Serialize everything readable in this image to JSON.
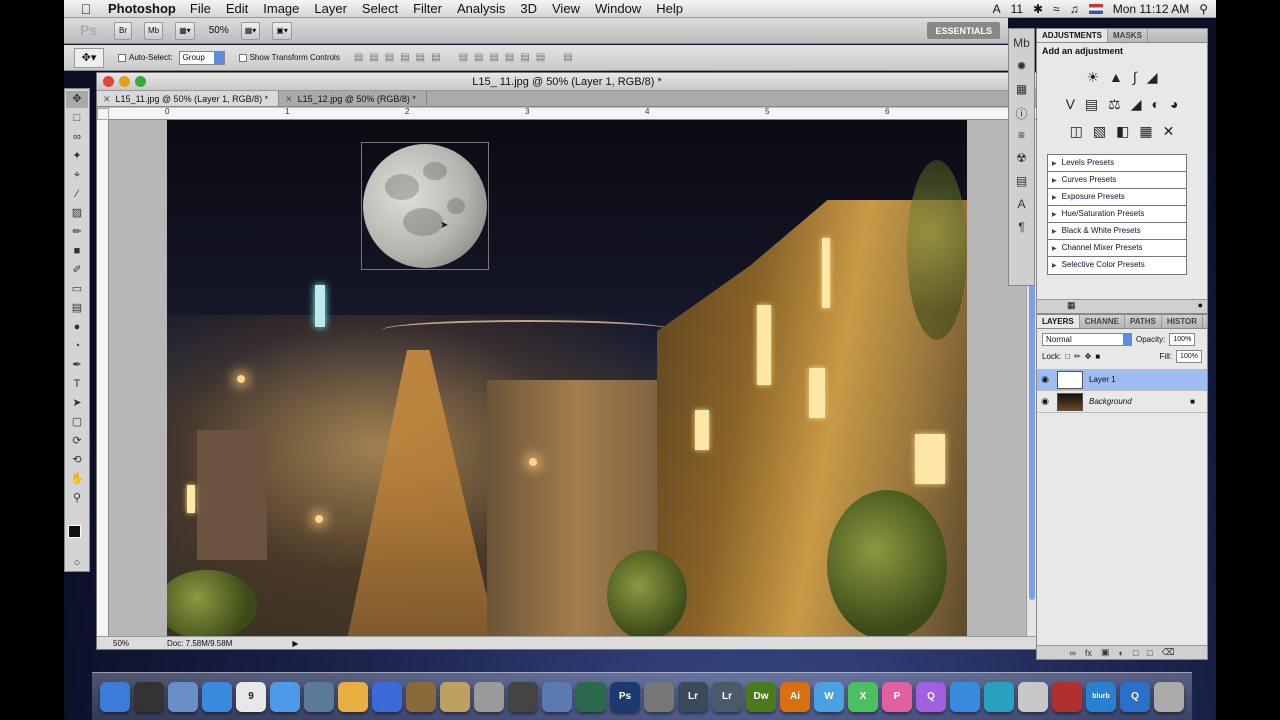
{
  "menubar": {
    "app": "Photoshop",
    "items": [
      "File",
      "Edit",
      "Image",
      "Layer",
      "Select",
      "Filter",
      "Analysis",
      "3D",
      "View",
      "Window",
      "Help"
    ],
    "status_11": "11",
    "clock": "Mon 11:12 AM"
  },
  "appbar": {
    "ps_logo": "Ps",
    "bridge_btn": "Br",
    "minibridge_btn": "Mb",
    "zoom": "50%",
    "workspace": "ESSENTIALS"
  },
  "options": {
    "auto_select_label": "Auto-Select:",
    "auto_select_value": "Group",
    "transform_label": "Show Transform Controls"
  },
  "document": {
    "title": "L15_ 11.jpg @ 50% (Layer 1, RGB/8) *",
    "tabs": [
      "L15_11.jpg @ 50% (Layer 1, RGB/8) *",
      "L15_12.jpg @ 50% (RGB/8) *"
    ],
    "ruler_numbers": [
      "0",
      "1",
      "2",
      "3",
      "4",
      "5",
      "6"
    ],
    "status_zoom": "50%",
    "doc_size": "Doc: 7.58M/9.58M"
  },
  "adjustments": {
    "tabs": [
      "ADJUSTMENTS",
      "MASKS"
    ],
    "heading": "Add an adjustment",
    "presets": [
      "Levels Presets",
      "Curves Presets",
      "Exposure Presets",
      "Hue/Saturation Presets",
      "Black & White Presets",
      "Channel Mixer Presets",
      "Selective Color Presets"
    ]
  },
  "layers": {
    "tabs": [
      "LAYERS",
      "CHANNE",
      "PATHS",
      "HISTOR"
    ],
    "blend_mode": "Normal",
    "opacity_label": "Opacity:",
    "opacity": "100%",
    "lock_label": "Lock:",
    "fill_label": "Fill:",
    "fill": "100%",
    "items": [
      {
        "name": "Layer 1",
        "selected": true
      },
      {
        "name": "Background",
        "selected": false
      }
    ]
  },
  "dock": {
    "items": [
      {
        "icon": "finder-icon",
        "label": "",
        "color": "#3d7bd8"
      },
      {
        "icon": "dashboard-icon",
        "label": "",
        "color": "#333333"
      },
      {
        "icon": "preview-icon",
        "label": "",
        "color": "#6a8fc8"
      },
      {
        "icon": "safari-icon",
        "label": "",
        "color": "#3a8ae0"
      },
      {
        "icon": "ical-icon",
        "label": "9",
        "color": "#e8e8e8"
      },
      {
        "icon": "ichat-icon",
        "label": "",
        "color": "#4c9ae8"
      },
      {
        "icon": "iphoto-icon",
        "label": "",
        "color": "#5a7a9a"
      },
      {
        "icon": "notes-icon",
        "label": "",
        "color": "#e8b040"
      },
      {
        "icon": "itunes-icon",
        "label": "",
        "color": "#3a6ad8"
      },
      {
        "icon": "photo-icon",
        "label": "",
        "color": "#8a6a3a"
      },
      {
        "icon": "garageband-icon",
        "label": "",
        "color": "#c0a060"
      },
      {
        "icon": "imovie-icon",
        "label": "",
        "color": "#9a9a9a"
      },
      {
        "icon": "clapper-icon",
        "label": "",
        "color": "#444444"
      },
      {
        "icon": "grid-icon",
        "label": "",
        "color": "#5a7ab0"
      },
      {
        "icon": "timemachine-icon",
        "label": "",
        "color": "#2a6a4a"
      },
      {
        "icon": "photoshop-icon",
        "label": "Ps",
        "color": "#1c3a70"
      },
      {
        "icon": "screen-icon",
        "label": "",
        "color": "#777777"
      },
      {
        "icon": "lightroom-icon",
        "label": "Lr",
        "color": "#3a4a5a"
      },
      {
        "icon": "lightroom2-icon",
        "label": "Lr",
        "color": "#4a5a6a"
      },
      {
        "icon": "dreamweaver-icon",
        "label": "Dw",
        "color": "#4a7a1a"
      },
      {
        "icon": "illustrator-icon",
        "label": "Ai",
        "color": "#d87010"
      },
      {
        "icon": "w-icon",
        "label": "W",
        "color": "#4aa0e0"
      },
      {
        "icon": "x-icon",
        "label": "X",
        "color": "#4ac060"
      },
      {
        "icon": "p-icon",
        "label": "P",
        "color": "#e060a0"
      },
      {
        "icon": "q-icon",
        "label": "Q",
        "color": "#a060e0"
      },
      {
        "icon": "contacts-icon",
        "label": "",
        "color": "#3a8ae0"
      },
      {
        "icon": "globe-icon",
        "label": "",
        "color": "#2aa0c0"
      },
      {
        "icon": "docs-icon",
        "label": "",
        "color": "#c8c8c8"
      },
      {
        "icon": "record-icon",
        "label": "",
        "color": "#b03030"
      },
      {
        "icon": "blurb-icon",
        "label": "blurb",
        "color": "#2a80d0"
      },
      {
        "icon": "quicktime-icon",
        "label": "Q",
        "color": "#2a70c8"
      },
      {
        "icon": "trash-icon",
        "label": "",
        "color": "#aaaaaa"
      }
    ]
  }
}
